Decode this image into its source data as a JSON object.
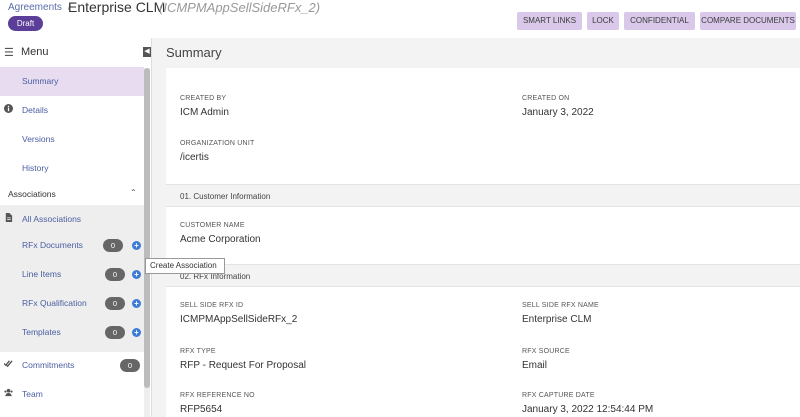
{
  "header": {
    "breadcrumb": "Agreements",
    "breadcrumb_sep": "/",
    "title": "Enterprise CLM",
    "subtitle": "(ICMPMAppSellSideRFx_2)",
    "status": "Draft",
    "buttons": {
      "smart_links": "SMART LINKS",
      "lock": "LOCK",
      "confidential": "CONFIDENTIAL",
      "compare": "COMPARE DOCUMENTS"
    }
  },
  "sidebar": {
    "menu_label": "Menu",
    "items": {
      "summary": "Summary",
      "details": "Details",
      "versions": "Versions",
      "history": "History"
    },
    "associations_label": "Associations",
    "associations": {
      "all": "All Associations",
      "rfx_documents": {
        "label": "RFx Documents",
        "count": "0"
      },
      "line_items": {
        "label": "Line Items",
        "count": "0"
      },
      "rfx_qualification": {
        "label": "RFx Qualification",
        "count": "0"
      },
      "templates": {
        "label": "Templates",
        "count": "0"
      }
    },
    "commitments": {
      "label": "Commitments",
      "count": "0"
    },
    "team": "Team",
    "tooltip": "Create Association"
  },
  "main": {
    "title": "Summary",
    "general": {
      "created_by_label": "CREATED BY",
      "created_by": "ICM Admin",
      "created_on_label": "CREATED ON",
      "created_on": "January 3, 2022",
      "org_unit_label": "ORGANIZATION UNIT",
      "org_unit": "/icertis"
    },
    "section1": {
      "title": "01. Customer Information",
      "customer_name_label": "CUSTOMER NAME",
      "customer_name": "Acme Corporation"
    },
    "section2": {
      "title": "02. RFx Information",
      "rfx_id_label": "SELL SIDE RFX ID",
      "rfx_id": "ICMPMAppSellSideRFx_2",
      "rfx_name_label": "SELL SIDE RFX NAME",
      "rfx_name": "Enterprise CLM",
      "rfx_type_label": "RFX TYPE",
      "rfx_type": "RFP - Request For Proposal",
      "rfx_source_label": "RFX SOURCE",
      "rfx_source": "Email",
      "rfx_ref_label": "RFX REFERENCE NO",
      "rfx_ref": "RFP5654",
      "rfx_capture_label": "RFX CAPTURE DATE",
      "rfx_capture": "January 3, 2022 12:54:44 PM"
    }
  },
  "colors": {
    "accent": "#5b3e98",
    "button_bg": "#d9c8ea",
    "active_nav": "#e7dcf0",
    "link": "#4a5ea0",
    "add_icon": "#3d7bd9"
  }
}
